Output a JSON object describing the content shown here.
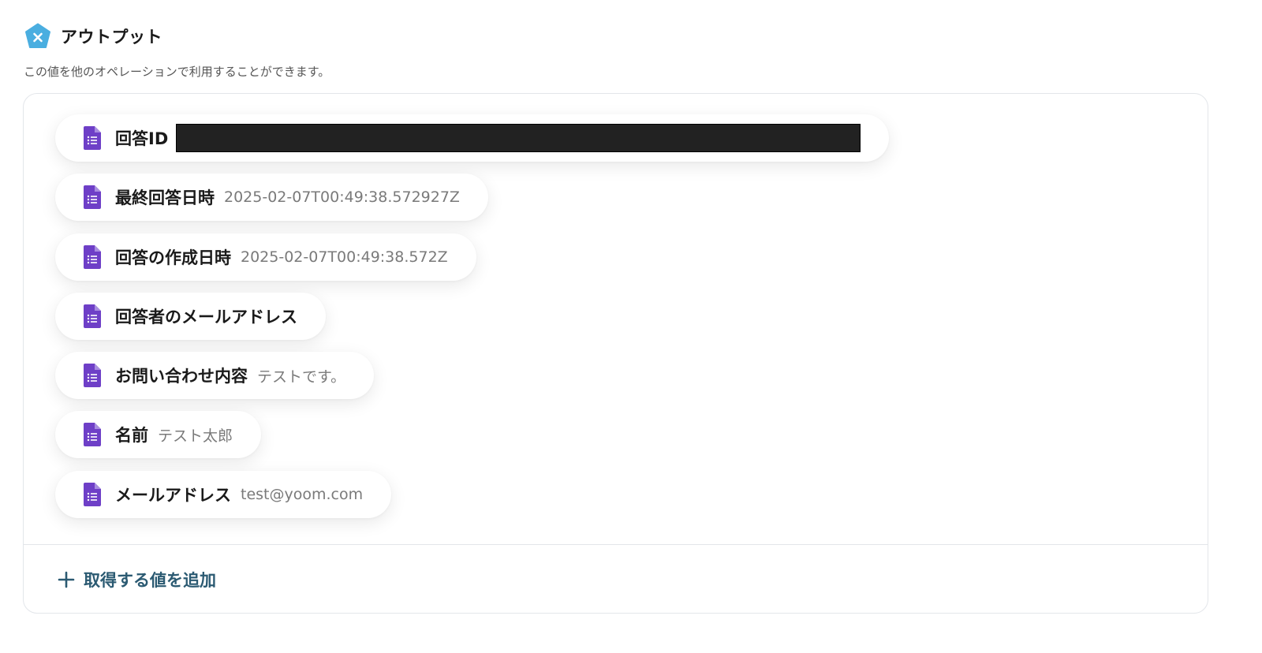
{
  "header": {
    "title": "アウトプット",
    "icon": "variable-pentagon-icon",
    "icon_color": "#4aaee0"
  },
  "subtitle": "この値を他のオペレーションで利用することができます。",
  "outputs": [
    {
      "label": "回答ID",
      "value": "",
      "redacted": true
    },
    {
      "label": "最終回答日時",
      "value": "2025-02-07T00:49:38.572927Z"
    },
    {
      "label": "回答の作成日時",
      "value": "2025-02-07T00:49:38.572Z"
    },
    {
      "label": "回答者のメールアドレス",
      "value": ""
    },
    {
      "label": "お問い合わせ内容",
      "value": "テストです。"
    },
    {
      "label": "名前",
      "value": "テスト太郎"
    },
    {
      "label": "メールアドレス",
      "value": "test@yoom.com"
    }
  ],
  "item_icon": "google-forms-icon",
  "item_icon_color": "#6e3fc7",
  "add_button": {
    "label": "取得する値を追加",
    "icon": "plus-icon",
    "color": "#2b5a72"
  }
}
